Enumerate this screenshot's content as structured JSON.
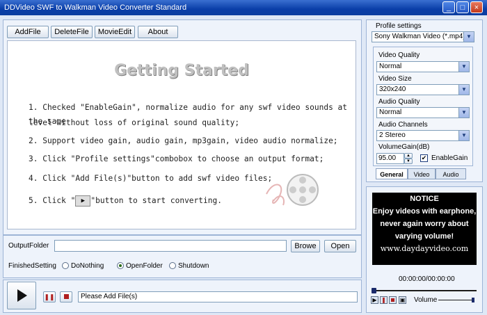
{
  "window": {
    "title": "DDVideo SWF to Walkman Video Converter Standard",
    "minimize": "_",
    "maximize": "□",
    "close": "×"
  },
  "toolbar": {
    "add_file": "AddFile",
    "delete_file": "DeleteFile",
    "movie_edit": "MovieEdit",
    "about": "About"
  },
  "getting_started": {
    "title": "Getting Started",
    "steps": [
      "1. Checked \"EnableGain\", normalize audio for any swf video sounds at the same",
      "   level without loss of original sound quality;",
      "2. Support video gain, audio gain, mp3gain, video audio normalize;",
      "3. Click \"Profile settings\"combobox to choose an output format;",
      "4. Click \"Add File(s)\"button to add swf video files;",
      "5. Click \"",
      "\"button to start converting."
    ]
  },
  "output": {
    "label": "OutputFolder",
    "value": "",
    "browse": "Browe",
    "open": "Open"
  },
  "finished": {
    "label": "FinishedSetting",
    "options": [
      "DoNothing",
      "OpenFolder",
      "Shutdown"
    ],
    "selected": "OpenFolder"
  },
  "status": {
    "text": "Please Add File(s)"
  },
  "profile": {
    "label": "Profile settings",
    "value": "Sony Walkman Video (*.mp4)",
    "video_quality_label": "Video Quality",
    "video_quality": "Normal",
    "video_size_label": "Video Size",
    "video_size": "320x240",
    "audio_quality_label": "Audio Quality",
    "audio_quality": "Normal",
    "audio_channels_label": "Audio Channels",
    "audio_channels": "2 Stereo",
    "volume_gain_label": "VolumeGain(dB)",
    "volume_gain": "95.00",
    "enable_gain_label": "EnableGain",
    "enable_gain_checked": true,
    "tabs": [
      "General",
      "Video",
      "Audio"
    ],
    "active_tab": "General"
  },
  "notice": {
    "title": "NOTICE",
    "line1": "Enjoy videos with earphone,",
    "line2": "never again worry about",
    "line3": "varying volume!",
    "url": "www.daydayvideo.com"
  },
  "player": {
    "time": "00:00:00/00:00:00",
    "volume_label": "Volume"
  },
  "colors": {
    "titlebar": "#0a3ea8",
    "panel_bg": "#eef3fb",
    "notice_bg": "#000000"
  }
}
